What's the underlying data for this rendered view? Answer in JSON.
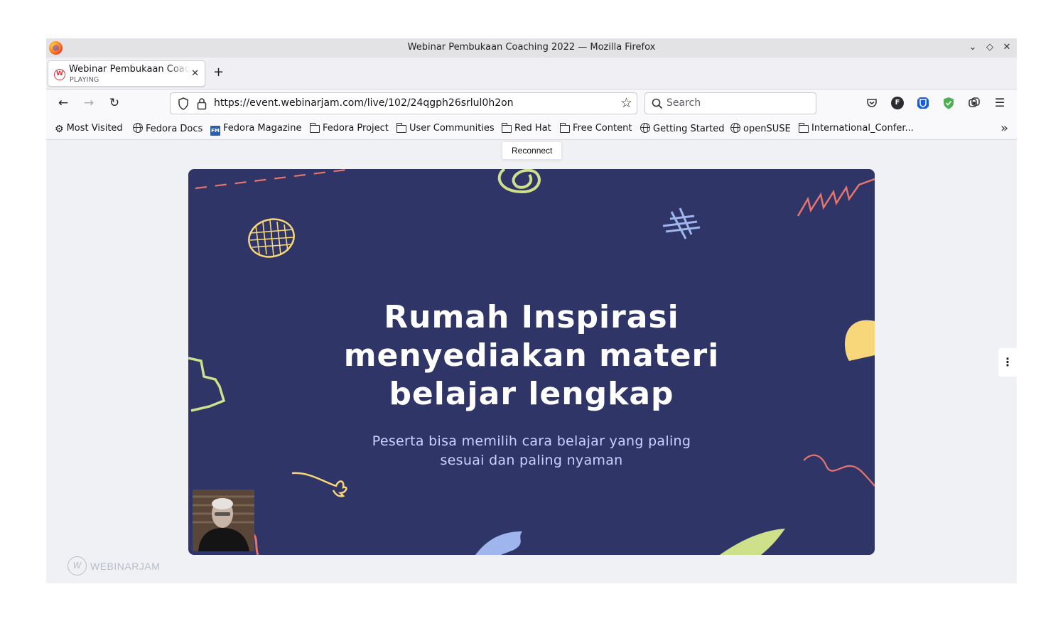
{
  "window": {
    "title": "Webinar Pembukaan Coaching 2022 — Mozilla Firefox"
  },
  "tab": {
    "title": "Webinar Pembukaan Coaching 2022",
    "status": "PLAYING"
  },
  "nav": {
    "url": "https://event.webinarjam.com/live/102/24qgph26srlul0h2on",
    "search_placeholder": "Search"
  },
  "bookmarks": [
    {
      "label": "Most Visited",
      "icon": "gear-icon"
    },
    {
      "label": "Fedora Docs",
      "icon": "globe-icon"
    },
    {
      "label": "Fedora Magazine",
      "icon": "fedora-magazine-icon"
    },
    {
      "label": "Fedora Project",
      "icon": "folder-icon"
    },
    {
      "label": "User Communities",
      "icon": "folder-icon"
    },
    {
      "label": "Red Hat",
      "icon": "folder-icon"
    },
    {
      "label": "Free Content",
      "icon": "folder-icon"
    },
    {
      "label": "Getting Started",
      "icon": "globe-icon"
    },
    {
      "label": "openSUSE",
      "icon": "globe-icon"
    },
    {
      "label": "International_Confer...",
      "icon": "folder-icon"
    }
  ],
  "toolbar_icons": {
    "account_letter": "F"
  },
  "content": {
    "tooltip": "Reconnect",
    "slide": {
      "title_line1": "Rumah Inspirasi",
      "title_line2": "menyediakan materi",
      "title_line3": "belajar lengkap",
      "subtitle_line1": "Peserta bisa memilih cara belajar yang paling",
      "subtitle_line2": "sesuai dan paling nyaman"
    },
    "brand": "WEBINARJAM"
  },
  "colors": {
    "slide_bg": "#2f3566",
    "doodle_yellow": "#f7d77a",
    "doodle_green": "#cfe08a",
    "doodle_blue": "#9fb5ee",
    "doodle_coral": "#e8756d"
  }
}
